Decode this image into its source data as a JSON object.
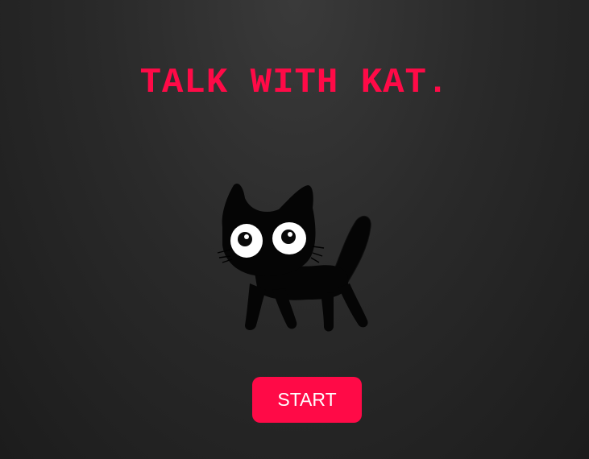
{
  "header": {
    "title": "TALK WITH KAT."
  },
  "mascot": {
    "icon": "black-cat-illustration"
  },
  "actions": {
    "start_label": "START"
  },
  "colors": {
    "accent": "#ff0a47",
    "background": "#262626",
    "button_text": "#ffffff"
  }
}
